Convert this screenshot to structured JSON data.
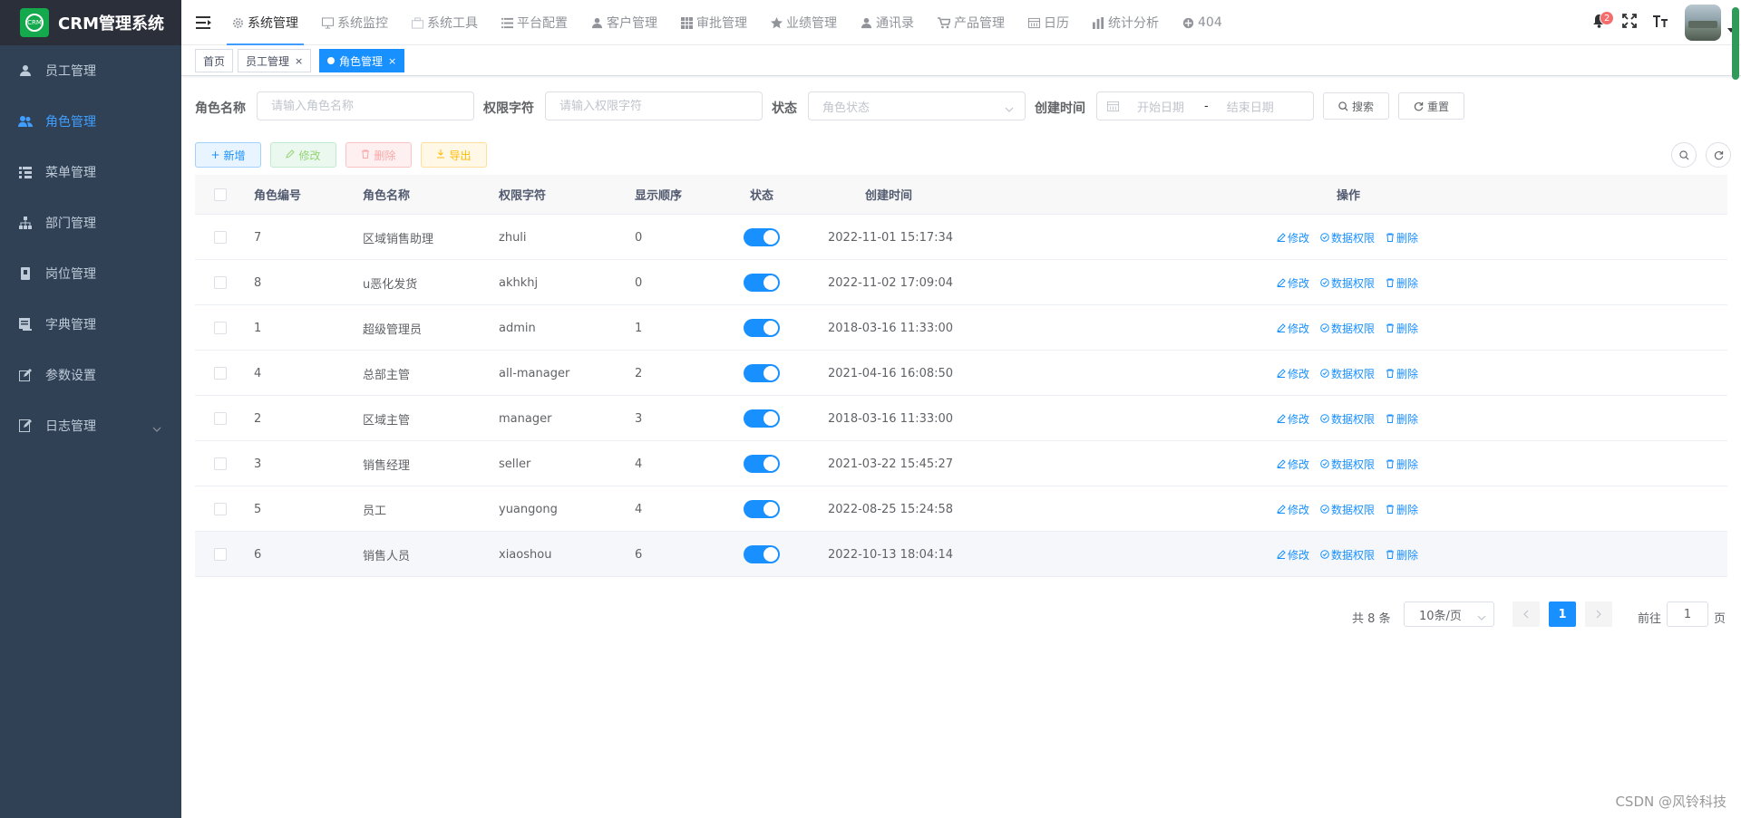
{
  "app": {
    "title": "CRM管理系统",
    "logo_text": "CRM"
  },
  "sidebar": {
    "items": [
      {
        "label": "员工管理",
        "icon": "user-icon"
      },
      {
        "label": "角色管理",
        "icon": "peoples-icon",
        "active": true
      },
      {
        "label": "菜单管理",
        "icon": "tree-table-icon"
      },
      {
        "label": "部门管理",
        "icon": "tree-icon"
      },
      {
        "label": "岗位管理",
        "icon": "post-icon"
      },
      {
        "label": "字典管理",
        "icon": "dict-icon"
      },
      {
        "label": "参数设置",
        "icon": "edit-icon"
      },
      {
        "label": "日志管理",
        "icon": "log-icon"
      }
    ]
  },
  "topnav": {
    "items": [
      {
        "label": "系统管理",
        "icon": "gear-icon",
        "active": true
      },
      {
        "label": "系统监控",
        "icon": "monitor-icon"
      },
      {
        "label": "系统工具",
        "icon": "tool-icon"
      },
      {
        "label": "平台配置",
        "icon": "list-icon"
      },
      {
        "label": "客户管理",
        "icon": "user-icon"
      },
      {
        "label": "审批管理",
        "icon": "table-icon"
      },
      {
        "label": "业绩管理",
        "icon": "star-icon"
      },
      {
        "label": "通讯录",
        "icon": "user-icon"
      },
      {
        "label": "产品管理",
        "icon": "cart-icon"
      },
      {
        "label": "日历",
        "icon": "calendar-icon"
      },
      {
        "label": "统计分析",
        "icon": "chart-icon"
      },
      {
        "label": "404",
        "icon": "404-icon"
      }
    ],
    "notification_count": "2"
  },
  "tags": [
    {
      "label": "首页"
    },
    {
      "label": "员工管理"
    },
    {
      "label": "角色管理",
      "active": true
    }
  ],
  "search": {
    "role_name_label": "角色名称",
    "role_name_placeholder": "请输入角色名称",
    "role_key_label": "权限字符",
    "role_key_placeholder": "请输入权限字符",
    "status_label": "状态",
    "status_placeholder": "角色状态",
    "created_label": "创建时间",
    "start_placeholder": "开始日期",
    "range_sep": "-",
    "end_placeholder": "结束日期",
    "search_btn": "搜索",
    "reset_btn": "重置"
  },
  "actions": {
    "add": "新增",
    "edit": "修改",
    "delete": "删除",
    "export": "导出"
  },
  "table": {
    "headers": [
      "角色编号",
      "角色名称",
      "权限字符",
      "显示顺序",
      "状态",
      "创建时间",
      "操作"
    ],
    "ops": {
      "edit": "修改",
      "data_scope": "数据权限",
      "delete": "删除"
    },
    "rows": [
      {
        "id": "7",
        "name": "区域销售助理",
        "key": "zhuli",
        "sort": "0",
        "created": "2022-11-01 15:17:34"
      },
      {
        "id": "8",
        "name": "u恶化发货",
        "key": "akhkhj",
        "sort": "0",
        "created": "2022-11-02 17:09:04"
      },
      {
        "id": "1",
        "name": "超级管理员",
        "key": "admin",
        "sort": "1",
        "created": "2018-03-16 11:33:00"
      },
      {
        "id": "4",
        "name": "总部主管",
        "key": "all-manager",
        "sort": "2",
        "created": "2021-04-16 16:08:50"
      },
      {
        "id": "2",
        "name": "区域主管",
        "key": "manager",
        "sort": "3",
        "created": "2018-03-16 11:33:00"
      },
      {
        "id": "3",
        "name": "销售经理",
        "key": "seller",
        "sort": "4",
        "created": "2021-03-22 15:45:27"
      },
      {
        "id": "5",
        "name": "员工",
        "key": "yuangong",
        "sort": "4",
        "created": "2022-08-25 15:24:58"
      },
      {
        "id": "6",
        "name": "销售人员",
        "key": "xiaoshou",
        "sort": "6",
        "created": "2022-10-13 18:04:14"
      }
    ]
  },
  "pagination": {
    "total": "共 8 条",
    "page_size": "10条/页",
    "current_page": "1",
    "goto_prefix": "前往",
    "goto_value": "1",
    "goto_suffix": "页"
  },
  "watermark": "CSDN @风铃科技",
  "colors": {
    "primary": "#1890ff",
    "sidebar_bg": "#304156",
    "logo_green": "#13a94c"
  }
}
